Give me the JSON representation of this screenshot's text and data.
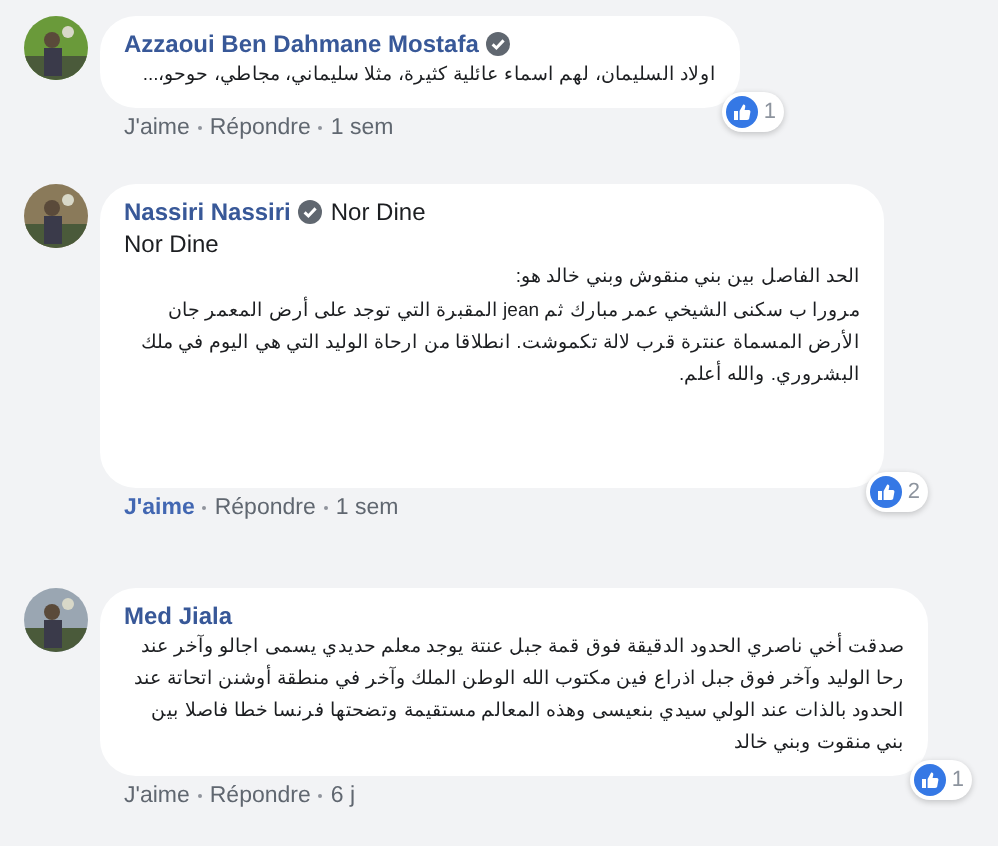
{
  "comments": [
    {
      "author": "Azzaoui Ben Dahmane Mostafa",
      "verified": true,
      "liked": false,
      "paragraphs": [
        "اولاد السليمان، لهم اسماء عائلية كثيرة، مثلا سليماني، مجاطي، حوحو،..."
      ],
      "reaction_count": "1",
      "like_label": "J'aime",
      "reply_label": "Répondre",
      "time": "1 sem"
    },
    {
      "author": "Nassiri Nassiri",
      "verified": true,
      "mention": "Nor Dine",
      "liked": true,
      "paragraphs": [
        "Nor Dine",
        "الحد الفاصل بين بني منقوش وبني خالد هو:",
        "مرورا ب سكنى الشيخي عمر مبارك ثم jean المقبرة التي توجد على أرض المعمر جان الأرض المسماة عنترة قرب لالة تكموشت. انطلاقا من ارحاة الوليد التي هي اليوم في ملك البشروري. والله أعلم."
      ],
      "reaction_count": "2",
      "like_label": "J'aime",
      "reply_label": "Répondre",
      "time": "1 sem"
    },
    {
      "author": "Med Jiala",
      "verified": false,
      "liked": false,
      "paragraphs": [
        "صدقت أخي ناصري الحدود الدقيقة فوق قمة جبل عنتة يوجد معلم حديدي يسمى اجالو وآخر عند رحا الوليد وآخر فوق جبل اذراع فين مكتوب الله الوطن الملك وآخر في منطقة أوشنن اتحاتة عند الحدود بالذات عند الولي سيدي بنعيسى وهذه المعالم مستقيمة وتضحتها فرنسا خطا فاصلا بين بني منقوت وبني خالد"
      ],
      "reaction_count": "1",
      "like_label": "J'aime",
      "reply_label": "Répondre",
      "time": "6 j"
    }
  ]
}
